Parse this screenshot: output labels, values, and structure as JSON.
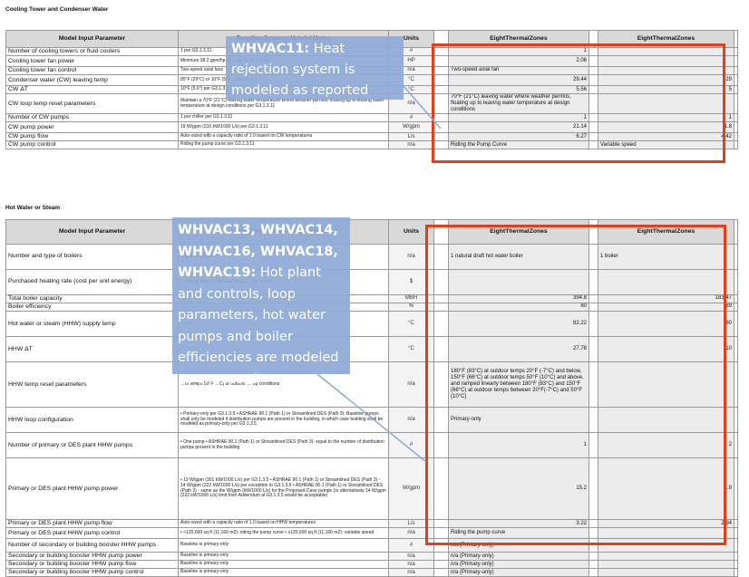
{
  "section1": {
    "title": "Cooling Tower and Condenser Water",
    "headers": [
      "Model Input Parameter",
      "Baseline Systems Helpful Notes",
      "Units",
      "EightThermalZones",
      "EightThermalZones"
    ],
    "rows": [
      {
        "param": "Number of cooling towers or fluid coolers",
        "notes": "1 per G3.1.3.11",
        "units": "#",
        "v1": "1",
        "v2": ""
      },
      {
        "param": "Cooling tower fan power",
        "notes": "Minimum 38.2 gpm/hp (3… per Table 6.8.1G",
        "units": "HP",
        "v1": "2.06",
        "v2": ""
      },
      {
        "param": "Cooling tower fan control",
        "notes": "Two-speed axial fans",
        "units": "n/a",
        "v1": "Two-speed axial fan",
        "v2": ""
      },
      {
        "param": "Condenser water (CW) leaving temp",
        "notes": "85°F (29°C) or 10°F (5.6… per G3.1.3.11",
        "units": "°C",
        "v1": "29.44",
        "v2": "29"
      },
      {
        "param": "CW ΔT",
        "notes": "10°F (5.6°) per G3.1.3.1…",
        "units": "°C",
        "v1": "5.56",
        "v2": "5"
      },
      {
        "param": "CW loop temp reset parameters",
        "notes": "Maintain a 70°F (21°C) leaving water temperature where weather permits, floating up to leaving water temperature at design conditions per G3.1.3.11",
        "units": "n/a",
        "v1": "70°F (21°C) leaving water where weather permits, floating up to leaving water temperature at design conditions",
        "v2": ""
      },
      {
        "param": "Number of CW pumps",
        "notes": "1 per chiller per G3.1.3.11",
        "units": "#",
        "v1": "1",
        "v2": "1"
      },
      {
        "param": "CW pump power",
        "notes": "19 W/gpm (310 kW/1000 L/s) per G3.1.3.11",
        "units": "W/gpm",
        "v1": "21.14",
        "v2": "1.8"
      },
      {
        "param": "CW pump flow",
        "notes": "Auto-sized with a capacity ratio of 1.0 based on CW temperatures",
        "units": "L/s",
        "v1": "6.27",
        "v2": "4.42"
      },
      {
        "param": "CW pump control",
        "notes": "Riding the pump curve per G3.1.3.11",
        "units": "n/a",
        "v1": "Riding the Pump Curve",
        "v2": "Variable speed"
      }
    ]
  },
  "section2": {
    "title": "Hot Water or Steam",
    "headers": [
      "Model Input Parameter",
      "Baseline Systems Helpful Notes",
      "Units",
      "EightThermalZones",
      "EightThermalZones"
    ],
    "rows": [
      {
        "param": "Number and type of boilers",
        "notes": "…ged as required",
        "units": "n/a",
        "v1": "1 natural draft hot water boiler",
        "v2": "1 boiler"
      },
      {
        "param": "Purchased heating rate (cost per unit energy)",
        "notes": "…energy rates … the total costs … the energy",
        "units": "$",
        "v1": "",
        "v2": ""
      },
      {
        "param": "Total boiler capacity",
        "notes": "…1.2.2",
        "units": "MBH",
        "v1": "394.8",
        "v2": "183.47"
      },
      {
        "param": "Boiler efficiency",
        "notes": "",
        "units": "%",
        "v1": "80",
        "v2": "89"
      },
      {
        "param": "Hot water or steam (HHW) supply temp",
        "notes": "…pply",
        "units": "°C",
        "v1": "82.22",
        "v2": "80"
      },
      {
        "param": "HHW ΔT",
        "notes": "…ions in",
        "units": "°C",
        "v1": "27.78",
        "v2": "10"
      },
      {
        "param": "HHW temp reset parameters",
        "notes": "…or temps 50°F …C) at outdoor … op conditions",
        "units": "n/a",
        "v1": "180°F (83°C) at outdoor temps 20°F (-7°C) and below, 150°F (66°C) at outdoor temps 50°F (10°C) and above, and ramped linearly between 180°F (83°C) and 150°F (66°C) at outdoor temps between 20°F(-7°C) and 50°F (10°C)",
        "v2": ""
      },
      {
        "param": "HHW loop configuration",
        "notes": "• Primary-only per G3.1.3.5 • ASHRAE 90.1 (Path 1) or Streamlined DES (Path 3): Baseline pumps shall only be modeled if distribution pumps are present in the building, in which case building shall be modeled as primary-only per G3.1.3.5",
        "units": "n/a",
        "v1": "Primary-only",
        "v2": ""
      },
      {
        "param": "Number of primary or DES plant HHW pumps",
        "notes": "• One pump • ASHRAE 90.1 (Path 1) or Streamlined DES (Path 3): equal to the number of distribution pumps present in the building",
        "units": "#",
        "v1": "1",
        "v2": "2"
      },
      {
        "param": "Primary or DES plant HHW pump power",
        "notes": "• 19 W/gpm (301 kW/1000 L/s) per G3.1.3.5 • ASHRAE 90.1 (Path 1) or Streamlined DES (Path 3) - 14 W/gpm (222 kW/1000 L/s) per exception to G3.1.3.5 • ASHRAE 90.1 (Path 1) or Streamlined DES (Path 3) - same as the W/gpm (kW/1000 L/s) for the Proposed Case pumps (or alternatively 14 W/gpm (222 kW/1000 L/s) limit from Addendum al G3.1.3.5 would be acceptable)",
        "units": "W/gpm",
        "v1": "15.2",
        "v2": "1.8"
      },
      {
        "param": "Primary or DES plant HHW pump flow",
        "notes": "Auto-sized with a capacity ratio of 1.0 based on HHW temperatures",
        "units": "L/s",
        "v1": "3.22",
        "v2": "2.94"
      },
      {
        "param": "Primary or DES plant HHW pump control",
        "notes": "• <120,000 sq ft (11,160 m2): riding the pump curve • ≥120,000 sq ft (11,160 m2): variable speed",
        "units": "n/a",
        "v1": "Riding the pump curve",
        "v2": ""
      },
      {
        "param": "Number of secondary or building booster HHW pumps",
        "notes": "Baseline is primary-only",
        "units": "#",
        "v1": "n/a (Primary-only)",
        "v2": ""
      },
      {
        "param": "Secondary or building booster HHW pump power",
        "notes": "Baseline is primary-only",
        "units": "n/a",
        "v1": "n/a (Primary-only)",
        "v2": ""
      },
      {
        "param": "Secondary or building booster HHW pump flow",
        "notes": "Baseline is primary-only",
        "units": "n/a",
        "v1": "n/a (Primary-only)",
        "v2": ""
      },
      {
        "param": "Secondary or building booster HHW pump control",
        "notes": "Baseline is primary-only",
        "units": "n/a",
        "v1": "n/a (Primary-only)",
        "v2": ""
      }
    ]
  },
  "callout1": {
    "bold": "WHVAC11:",
    "text": " Heat rejection system is modeled as reported"
  },
  "callout2": {
    "bold": "WHVAC13, WHVAC14, WHVAC16,  WHVAC18, WHVAC19:",
    "text": " Hot plant and controls, loop parameters, hot water pumps and boiler efficiencies are modeled as expected"
  },
  "colors": {
    "highlight": "#e0401e",
    "callout": "#8eaad6",
    "header_bg": "#d9d9d9"
  }
}
